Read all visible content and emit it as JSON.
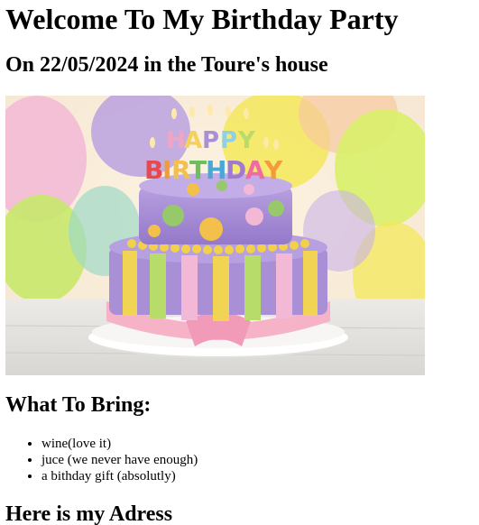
{
  "page": {
    "title": "Welcome To My Birthday Party",
    "subtitle": "On 22/05/2024 in the Toure's house"
  },
  "image": {
    "cake_top_text": "HAPPY",
    "cake_bottom_text": "BIRTHDAY",
    "colors": {
      "frosting_purple": "#a98fd6",
      "balloon_green": "#c8e86a",
      "balloon_yellow": "#f3e85a",
      "balloon_pink": "#f2b8d6",
      "ribbon_pink": "#f6b3c8",
      "stripe_yellow": "#f2d455",
      "stripe_green": "#b8dc6a",
      "dot_orange": "#f3c14b",
      "dot_green": "#97c96a"
    }
  },
  "bring": {
    "heading": "What To Bring:",
    "items": [
      "wine(love it)",
      "juce (we never have enough)",
      "a bithday gift (absolutly)"
    ]
  },
  "address": {
    "heading": "Here is my Adress"
  }
}
